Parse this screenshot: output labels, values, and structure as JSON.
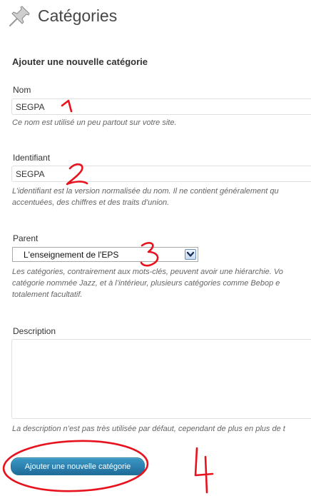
{
  "header": {
    "title": "Catégories",
    "icon": "pushpin-icon"
  },
  "form": {
    "heading": "Ajouter une nouvelle catégorie",
    "name": {
      "label": "Nom",
      "value": "SEGPA",
      "help": "Ce nom est utilisé un peu partout sur votre site."
    },
    "slug": {
      "label": "Identifiant",
      "value": "SEGPA",
      "help_lines": [
        "L’identifiant est la version normalisée du nom. Il ne contient généralement qu",
        "accentuées, des chiffres et des traits d’union."
      ]
    },
    "parent": {
      "label": "Parent",
      "selected": "L'enseignement de l'EPS",
      "help_lines": [
        "Les catégories, contrairement aux mots-clés, peuvent avoir une hiérarchie. Vo",
        "catégorie nommée Jazz, et à l’intérieur, plusieurs catégories comme Bebop e",
        "totalement facultatif."
      ]
    },
    "description": {
      "label": "Description",
      "value": "",
      "help": "La description n’est pas très utilisée par défaut, cependant de plus en plus de t"
    },
    "submit_label": "Ajouter une nouvelle catégorie"
  },
  "annotations": {
    "color": "#e8121e",
    "marks": [
      "1",
      "2",
      "3",
      "4"
    ]
  }
}
